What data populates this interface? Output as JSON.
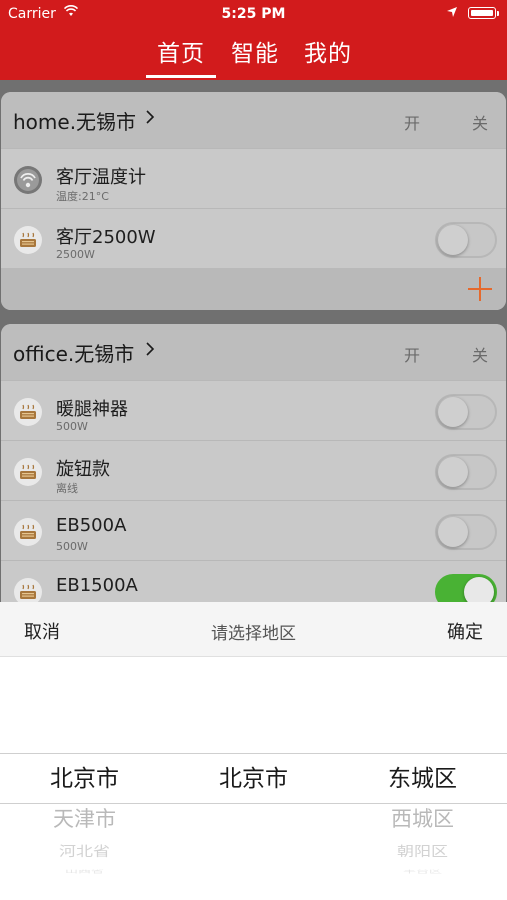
{
  "status_bar": {
    "carrier": "Carrier",
    "time": "5:25 PM"
  },
  "nav": {
    "tabs": [
      {
        "label": "首页",
        "active": true
      },
      {
        "label": "智能"
      },
      {
        "label": "我的"
      }
    ]
  },
  "colors": {
    "brand_red": "#d21b1c",
    "toggle_on": "#49b234",
    "add_plus": "#e5692d"
  },
  "groups": [
    {
      "title": "home.无锡市",
      "on_label": "开",
      "off_label": "关",
      "devices": [
        {
          "name": "客厅温度计",
          "detail": "温度:21°C",
          "icon": "thermometer-icon",
          "has_toggle": false
        },
        {
          "name": "客厅2500W",
          "detail": "2500W",
          "icon": "heater-icon",
          "has_toggle": true,
          "on": false
        }
      ],
      "add_icon": "plus-icon"
    },
    {
      "title": "office.无锡市",
      "on_label": "开",
      "off_label": "关",
      "devices": [
        {
          "name": "暖腿神器",
          "detail": "500W",
          "icon": "heater-icon",
          "has_toggle": true,
          "on": false
        },
        {
          "name": "旋钮款",
          "detail": "离线",
          "icon": "heater-icon",
          "has_toggle": true,
          "on": false
        },
        {
          "name": "EB500A",
          "detail": "500W",
          "icon": "heater-icon",
          "has_toggle": true,
          "on": false
        },
        {
          "name": "EB1500A",
          "detail": "",
          "icon": "heater-icon",
          "has_toggle": true,
          "on": true
        }
      ]
    }
  ],
  "picker": {
    "cancel": "取消",
    "title": "请选择地区",
    "confirm": "确定",
    "columns": [
      {
        "selected": "北京市",
        "next": [
          "天津市",
          "河北省",
          "山西省"
        ]
      },
      {
        "selected": "北京市",
        "next": []
      },
      {
        "selected": "东城区",
        "next": [
          "西城区",
          "朝阳区",
          "丰台区"
        ]
      }
    ]
  }
}
